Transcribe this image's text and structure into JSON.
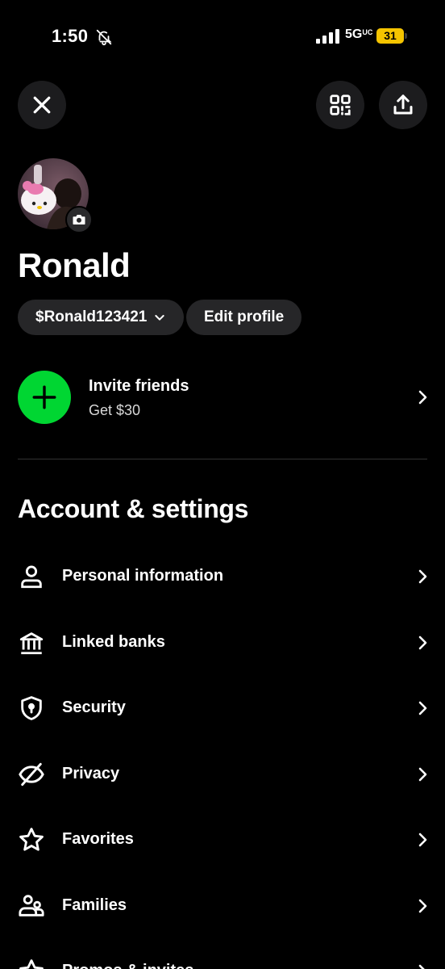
{
  "status_bar": {
    "time": "1:50",
    "network": "5G",
    "network_sup": "UC",
    "battery_level": "31",
    "battery_fraction": 0.31,
    "battery_color": "#f5c400"
  },
  "header": {
    "close_icon": "close-icon",
    "qr_icon": "qr-scan-icon",
    "share_icon": "share-icon"
  },
  "profile": {
    "name": "Ronald",
    "cashtag": "$Ronald123421",
    "edit_label": "Edit profile"
  },
  "invite": {
    "title": "Invite friends",
    "subtitle": "Get $30",
    "accent": "#00d632"
  },
  "settings": {
    "title": "Account & settings",
    "items": [
      {
        "label": "Personal information",
        "icon": "person-icon"
      },
      {
        "label": "Linked banks",
        "icon": "bank-icon"
      },
      {
        "label": "Security",
        "icon": "shield-icon"
      },
      {
        "label": "Privacy",
        "icon": "eye-off-icon"
      },
      {
        "label": "Favorites",
        "icon": "star-icon"
      },
      {
        "label": "Families",
        "icon": "family-icon"
      },
      {
        "label": "Promos & invites",
        "icon": "promo-star-icon"
      }
    ]
  }
}
